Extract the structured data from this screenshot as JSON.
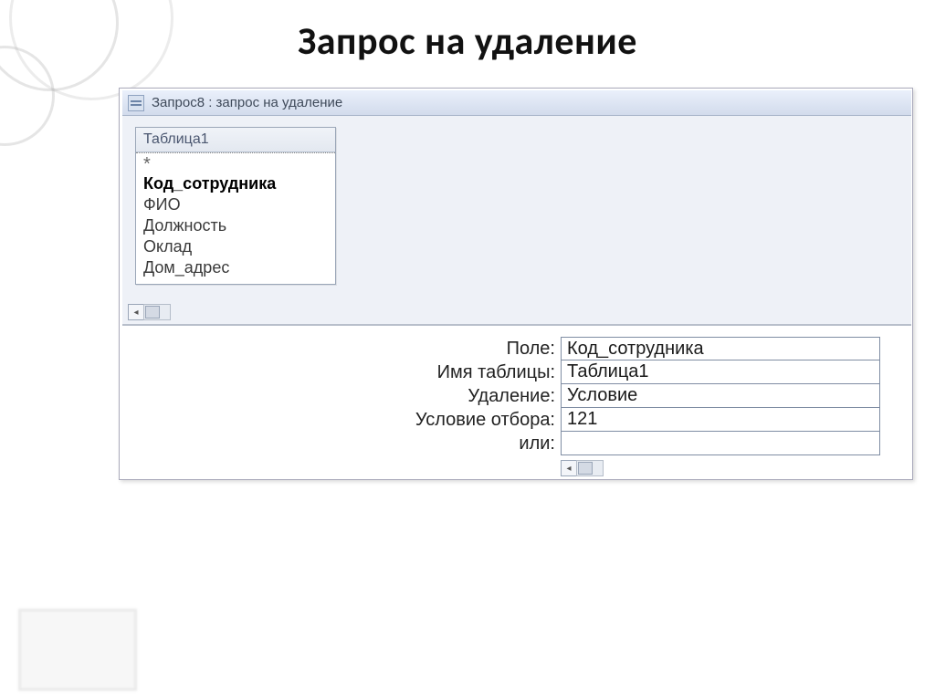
{
  "slide": {
    "title": "Запрос на удаление"
  },
  "window": {
    "title": "Запрос8 : запрос на удаление"
  },
  "table": {
    "name": "Таблица1",
    "star": "*",
    "fields": {
      "f0": "Код_сотрудника",
      "f1": "ФИО",
      "f2": "Должность",
      "f3": "Оклад",
      "f4": "Дом_адрес"
    }
  },
  "grid": {
    "labels": {
      "field": "Поле:",
      "table": "Имя таблицы:",
      "delete": "Удаление:",
      "criteria": "Условие отбора:",
      "or": "или:"
    },
    "values": {
      "field": "Код_сотрудника",
      "table": "Таблица1",
      "delete": "Условие",
      "criteria": "121",
      "or": ""
    }
  }
}
